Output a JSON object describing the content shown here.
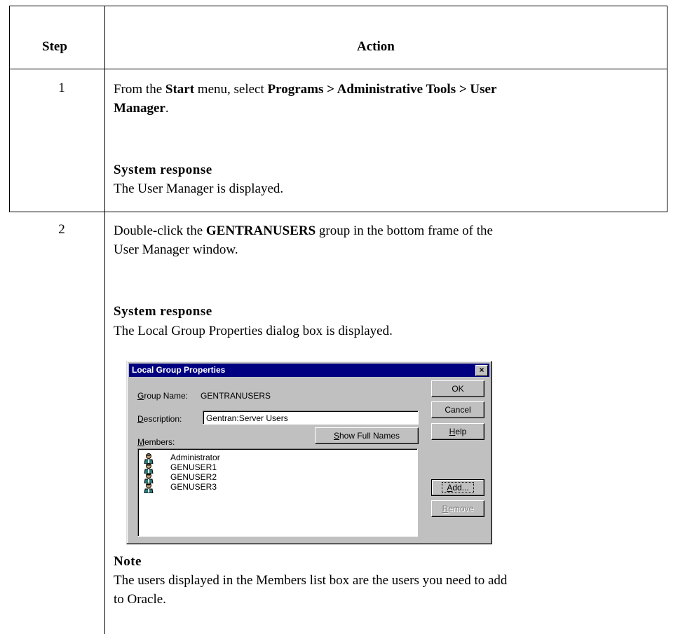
{
  "table": {
    "header_step": "Step",
    "header_action": "Action"
  },
  "rows": [
    {
      "step": "1",
      "instruction_pre": "From the ",
      "instruction_b1": "Start",
      "instruction_mid": " menu, select ",
      "instruction_b2": "Programs > Administrative Tools > User",
      "instruction_b3": "Manager",
      "instruction_end": ".",
      "response_title": "System response",
      "response_text": "The User Manager is displayed."
    },
    {
      "step": "2",
      "instruction_pre": "Double-click the ",
      "instruction_b1": "GENTRANUSERS",
      "instruction_mid": " group in the bottom frame of the",
      "instruction_line2": "User Manager window.",
      "response_title": "System response",
      "response_text": "The Local Group Properties dialog box is displayed.",
      "note_title": "Note",
      "note_line1": "The users displayed in the Members list box are the users you need to add",
      "note_line2": "to Oracle."
    }
  ],
  "dialog": {
    "title": "Local Group Properties",
    "close_glyph": "×",
    "group_name_label_u": "G",
    "group_name_label_rest": "roup Name:",
    "group_name_value": "GENTRANUSERS",
    "description_label_u": "D",
    "description_label_rest": "escription:",
    "description_value": "Gentran:Server Users",
    "members_label_u": "M",
    "members_label_rest": "embers:",
    "show_full_names_u": "S",
    "show_full_names_rest": "how Full Names",
    "ok_label": "OK",
    "cancel_label": "Cancel",
    "help_u": "H",
    "help_rest": "elp",
    "add_u": "A",
    "add_rest": "dd...",
    "remove_u": "R",
    "remove_rest": "emove",
    "members": [
      "Administrator",
      "GENUSER1",
      "GENUSER2",
      "GENUSER3"
    ],
    "member_icon": "user-icon"
  }
}
